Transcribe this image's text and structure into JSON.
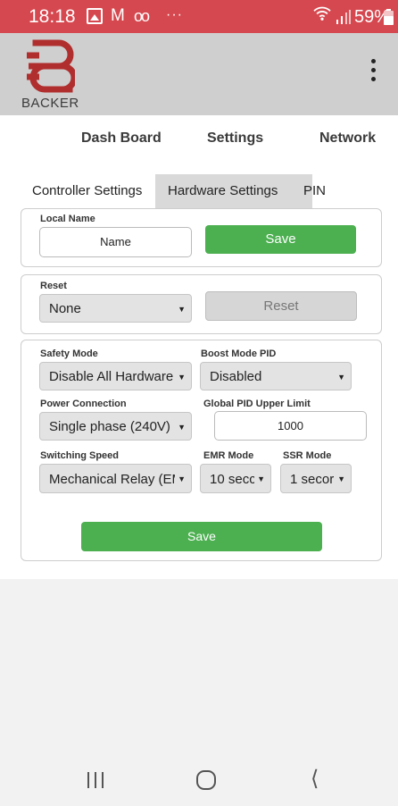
{
  "status_bar": {
    "time": "18:18",
    "battery_percent": "59%",
    "icons": [
      "gallery-icon",
      "mail-icon",
      "voicemail-icon",
      "more-dots-icon",
      "wifi-icon",
      "signal-icon",
      "battery-icon"
    ],
    "dots": "···",
    "mail_glyph": "M",
    "voicemail_glyph": "oo",
    "background_color": "#d6484f"
  },
  "app_header": {
    "brand": "BACKER",
    "brand_color": "#b02e2e",
    "menu_icon": "kebab-menu-icon"
  },
  "top_nav": {
    "items": [
      "Dash Board",
      "Settings",
      "Network"
    ]
  },
  "tabs": {
    "items": [
      "Controller Settings",
      "Hardware Settings",
      "PIN"
    ],
    "active": "Hardware Settings"
  },
  "local_name": {
    "label": "Local Name",
    "value": "Name",
    "save_label": "Save"
  },
  "reset": {
    "label": "Reset",
    "selected": "None",
    "button_label": "Reset"
  },
  "hardware": {
    "safety_mode": {
      "label": "Safety Mode",
      "selected": "Disable All Hardware ("
    },
    "boost_mode_pid": {
      "label": "Boost Mode PID",
      "selected": "Disabled"
    },
    "power_connection": {
      "label": "Power Connection",
      "selected": "Single phase (240V)"
    },
    "global_pid_upper_limit": {
      "label": "Global PID Upper Limit",
      "value": "1000"
    },
    "switching_speed": {
      "label": "Switching Speed",
      "selected": "Mechanical Relay (EM"
    },
    "emr_mode": {
      "label": "EMR Mode",
      "selected": "10 secc"
    },
    "ssr_mode": {
      "label": "SSR Mode",
      "selected": "1 secor"
    },
    "save_label": "Save"
  },
  "colors": {
    "save_green": "#4caf50",
    "active_tab": "#d9d9d9",
    "header_grey": "#cfcfcf"
  },
  "system_nav": {
    "icons": [
      "recent-apps-icon",
      "home-icon",
      "back-icon"
    ]
  }
}
